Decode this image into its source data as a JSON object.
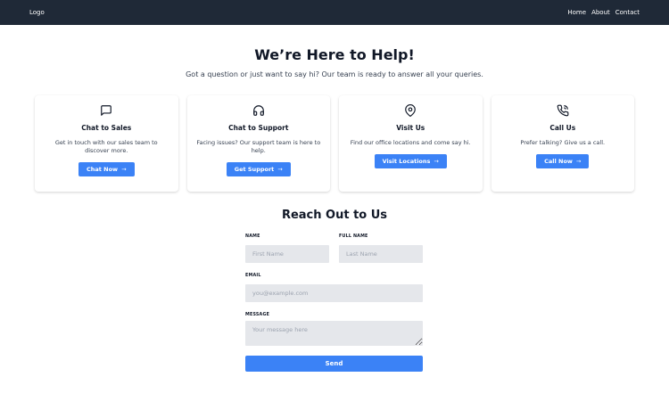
{
  "navbar": {
    "logo": "Logo",
    "links": [
      "Home",
      "About",
      "Contact"
    ]
  },
  "hero": {
    "title": "We’re Here to Help!",
    "subtitle": "Got a question or just want to say hi? Our team is ready to answer all your queries."
  },
  "cards": [
    {
      "icon": "chat-icon",
      "title": "Chat to Sales",
      "description": "Get in touch with our sales team to discover more.",
      "button": "Chat Now"
    },
    {
      "icon": "headphones-icon",
      "title": "Chat to Support",
      "description": "Facing issues? Our support team is here to help.",
      "button": "Get Support"
    },
    {
      "icon": "location-pin-icon",
      "title": "Visit Us",
      "description": "Find our office locations and come say hi.",
      "button": "Visit Locations"
    },
    {
      "icon": "phone-icon",
      "title": "Call Us",
      "description": "Prefer talking? Give us a call.",
      "button": "Call Now"
    }
  ],
  "form": {
    "title": "Reach Out to Us",
    "name_label": "Name",
    "fullname_label": "Full Name",
    "first_name_placeholder": "First Name",
    "last_name_placeholder": "Last Name",
    "email_label": "Email",
    "email_placeholder": "you@example.com",
    "message_label": "Message",
    "message_placeholder": "Your message here",
    "send_label": "Send"
  },
  "colors": {
    "navbar_bg": "#1f2937",
    "accent": "#3b82f6",
    "input_bg": "#e5e7eb"
  }
}
